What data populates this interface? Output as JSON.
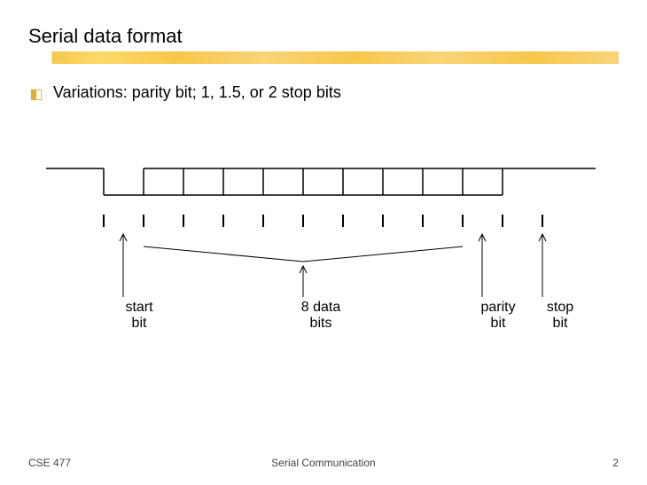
{
  "title": "Serial data format",
  "bullet": {
    "text": "Variations: parity bit; 1, 1.5, or 2 stop bits"
  },
  "labels": {
    "start": "start\nbit",
    "data": "8 data\nbits",
    "parity": "parity\nbit",
    "stop": "stop\nbit"
  },
  "footer": {
    "left": "CSE 477",
    "center": "Serial Communication",
    "right": "2"
  },
  "chart_data": {
    "type": "timing-diagram",
    "description": "UART serial frame waveform",
    "idle_level": "high",
    "segments": [
      {
        "name": "idle",
        "level": "high",
        "width_bits": 1
      },
      {
        "name": "start",
        "level": "low",
        "width_bits": 1
      },
      {
        "name": "d0",
        "level": "open",
        "width_bits": 1
      },
      {
        "name": "d1",
        "level": "open",
        "width_bits": 1
      },
      {
        "name": "d2",
        "level": "open",
        "width_bits": 1
      },
      {
        "name": "d3",
        "level": "open",
        "width_bits": 1
      },
      {
        "name": "d4",
        "level": "open",
        "width_bits": 1
      },
      {
        "name": "d5",
        "level": "open",
        "width_bits": 1
      },
      {
        "name": "d6",
        "level": "open",
        "width_bits": 1
      },
      {
        "name": "d7",
        "level": "open",
        "width_bits": 1
      },
      {
        "name": "parity",
        "level": "open",
        "width_bits": 1
      },
      {
        "name": "stop",
        "level": "high",
        "width_bits": 1
      }
    ],
    "tick_count": 12,
    "annotations": [
      {
        "label_key": "start",
        "points_to": "start",
        "kind": "arrow"
      },
      {
        "label_key": "data",
        "points_to": "d0-d7 span",
        "kind": "brace"
      },
      {
        "label_key": "parity",
        "points_to": "parity",
        "kind": "arrow"
      },
      {
        "label_key": "stop",
        "points_to": "stop",
        "kind": "arrow"
      }
    ]
  }
}
